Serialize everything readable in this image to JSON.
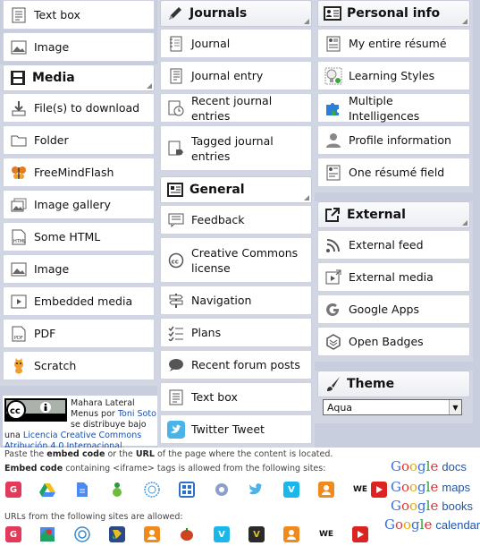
{
  "col1": {
    "items_top": [
      "Text box",
      "Image"
    ],
    "media_header": "Media",
    "media_items": [
      "File(s) to download",
      "Folder",
      "FreeMindFlash",
      "Image gallery",
      "Some HTML",
      "Image",
      "Embedded media",
      "PDF",
      "Scratch"
    ]
  },
  "credit": {
    "text1": "Mahara Lateral Menus por",
    "author": "Toni Soto",
    "text2": "se distribuye bajo una",
    "license": "Licencia Creative Commons Atribución 4.0 Internacional",
    "end": "."
  },
  "col2": {
    "journals_header": "Journals",
    "journals_items": [
      "Journal",
      "Journal entry",
      "Recent journal entries",
      "Tagged journal entries"
    ],
    "general_header": "General",
    "general_items": [
      "Feedback",
      "Creative Commons license",
      "Navigation",
      "Plans",
      "Recent forum posts",
      "Text box",
      "Twitter Tweet"
    ]
  },
  "col3": {
    "personal_header": "Personal info",
    "personal_items": [
      "My entire résumé",
      "Learning Styles",
      "Multiple Intelligences",
      "Profile information",
      "One résumé field"
    ],
    "external_header": "External",
    "external_items": [
      "External feed",
      "External media",
      "Google Apps",
      "Open Badges"
    ],
    "theme_header": "Theme",
    "theme_value": "Aqua"
  },
  "bottom": {
    "line1_pre": "Paste the",
    "line1_b1": "embed code",
    "line1_mid": "or the",
    "line1_b2": "URL",
    "line1_post": "of the page where the content is located.",
    "line2_b": "Embed code",
    "line2_post": "containing <iframe> tags is allowed from the following sites:",
    "line3": "URLs from the following sites are allowed:",
    "google_services": [
      "docs",
      "maps",
      "books",
      "calendar"
    ],
    "we_label": "WE"
  }
}
